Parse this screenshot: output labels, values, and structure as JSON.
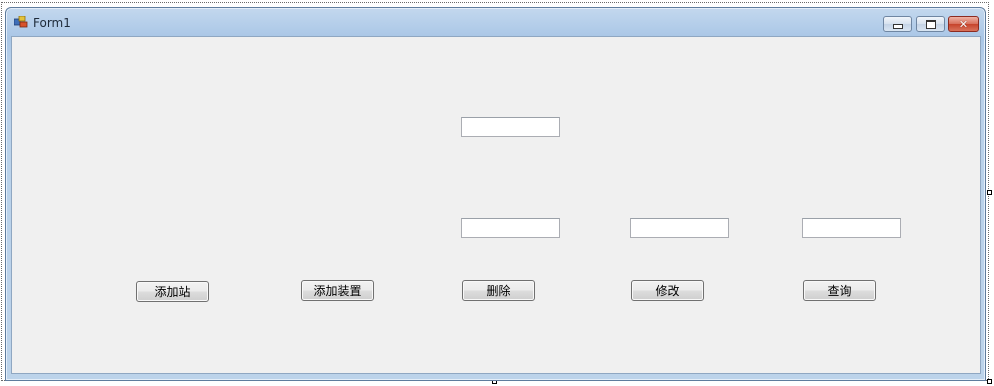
{
  "window": {
    "title": "Form1"
  },
  "inputs": [
    {
      "value": ""
    },
    {
      "value": ""
    },
    {
      "value": ""
    },
    {
      "value": ""
    }
  ],
  "buttons": {
    "add_station": "添加站",
    "add_device": "添加装置",
    "delete": "删除",
    "modify": "修改",
    "query": "查询"
  },
  "icons": {
    "app": "form-app-icon",
    "minimize": "minimize-icon",
    "maximize": "maximize-icon",
    "close": "close-icon"
  },
  "colors": {
    "client_background": "#f0f0f0",
    "titlebar_accent": "#a9c6e6",
    "close_button": "#c6432b"
  }
}
